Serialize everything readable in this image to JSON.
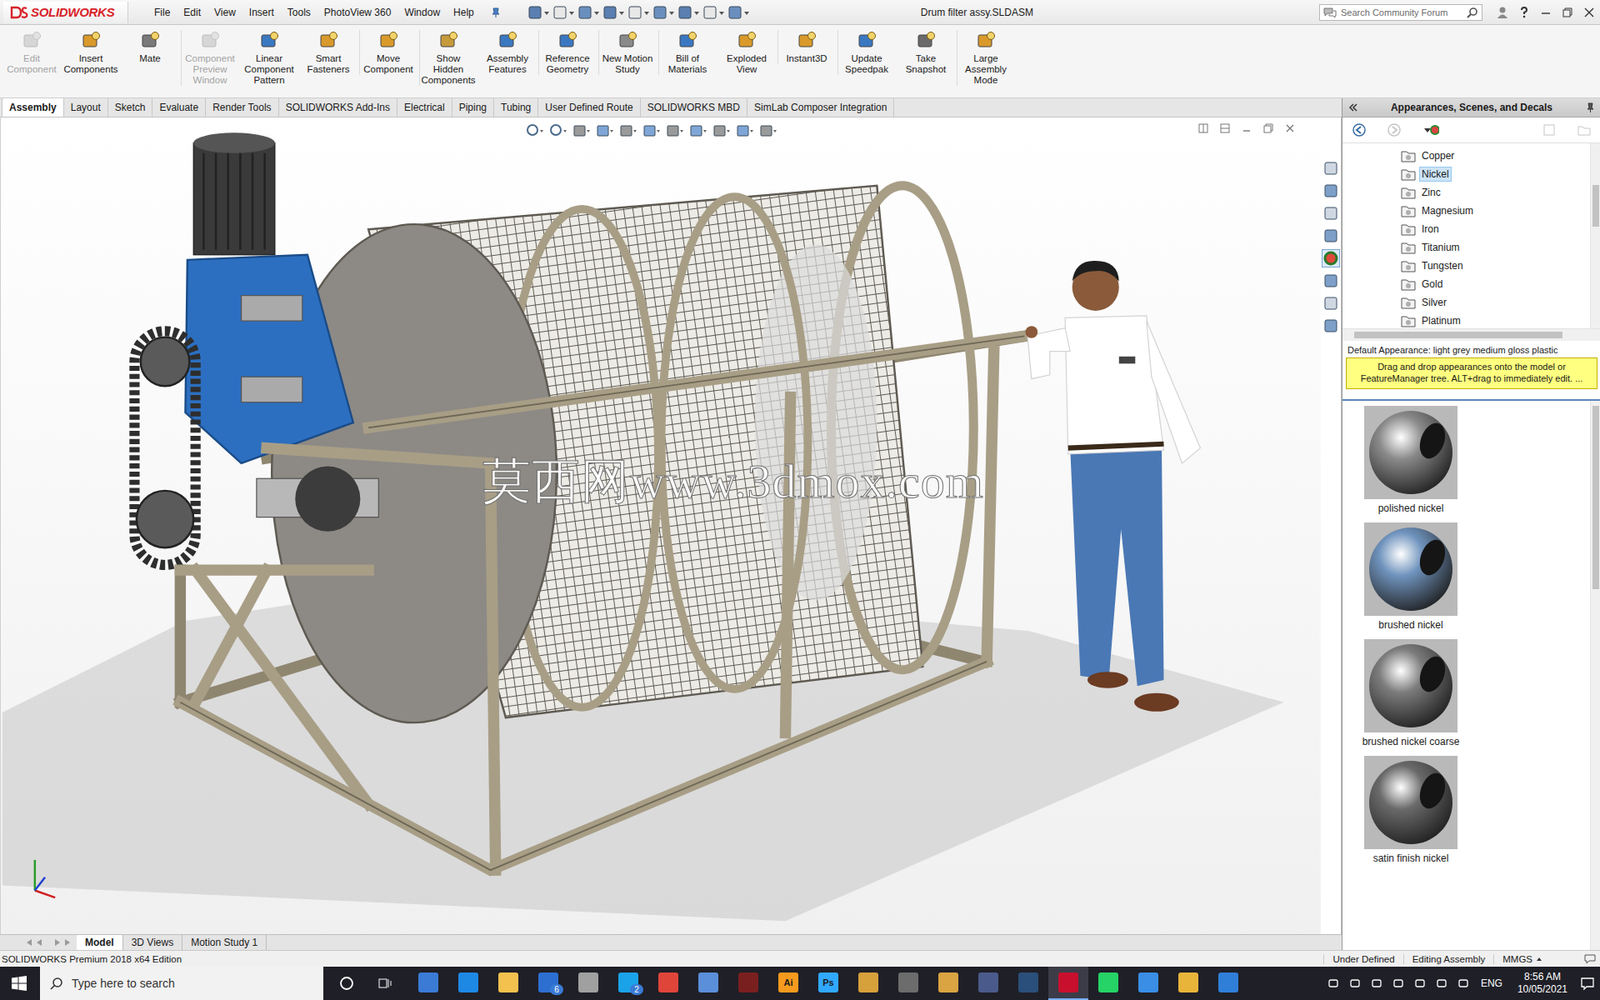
{
  "app": {
    "logo": "SOLIDWORKS"
  },
  "menu": [
    "File",
    "Edit",
    "View",
    "Insert",
    "Tools",
    "PhotoView 360",
    "Window",
    "Help"
  ],
  "window": {
    "title": "Drum filter assy.SLDASM"
  },
  "search": {
    "placeholder": "Search Community Forum"
  },
  "ribbon": [
    {
      "label": "Edit Component",
      "disabled": true
    },
    {
      "label": "Insert Components",
      "disabled": false
    },
    {
      "label": "Mate",
      "disabled": false
    },
    {
      "label": "Component Preview Window",
      "disabled": true
    },
    {
      "label": "Linear Component Pattern",
      "disabled": false
    },
    {
      "label": "Smart Fasteners",
      "disabled": false
    },
    {
      "label": "Move Component",
      "disabled": false
    },
    {
      "label": "Show Hidden Components",
      "disabled": false
    },
    {
      "label": "Assembly Features",
      "disabled": false
    },
    {
      "label": "Reference Geometry",
      "disabled": false
    },
    {
      "label": "New Motion Study",
      "disabled": false
    },
    {
      "label": "Bill of Materials",
      "disabled": false
    },
    {
      "label": "Exploded View",
      "disabled": false
    },
    {
      "label": "Instant3D",
      "disabled": false
    },
    {
      "label": "Update Speedpak",
      "disabled": false
    },
    {
      "label": "Take Snapshot",
      "disabled": false
    },
    {
      "label": "Large Assembly Mode",
      "disabled": false
    }
  ],
  "tabs": [
    {
      "label": "Assembly",
      "selected": true
    },
    {
      "label": "Layout",
      "selected": false
    },
    {
      "label": "Sketch",
      "selected": false
    },
    {
      "label": "Evaluate",
      "selected": false
    },
    {
      "label": "Render Tools",
      "selected": false
    },
    {
      "label": "SOLIDWORKS Add-Ins",
      "selected": false
    },
    {
      "label": "Electrical",
      "selected": false
    },
    {
      "label": "Piping",
      "selected": false
    },
    {
      "label": "Tubing",
      "selected": false
    },
    {
      "label": "User Defined Route",
      "selected": false
    },
    {
      "label": "SOLIDWORKS MBD",
      "selected": false
    },
    {
      "label": "SimLab Composer Integration",
      "selected": false
    }
  ],
  "viewport": {
    "watermark": "莫西网www.3dmox.com"
  },
  "bottom_tabs": [
    {
      "label": "Model",
      "selected": true
    },
    {
      "label": "3D Views",
      "selected": false
    },
    {
      "label": "Motion Study 1",
      "selected": false
    }
  ],
  "status_bar": {
    "edition": "SOLIDWORKS Premium 2018 x64 Edition",
    "state": "Under Defined",
    "mode": "Editing Assembly",
    "units": "MMGS"
  },
  "task_pane": {
    "title": "Appearances, Scenes, and Decals",
    "tree": [
      {
        "label": "Copper",
        "selected": false
      },
      {
        "label": "Nickel",
        "selected": true
      },
      {
        "label": "Zinc",
        "selected": false
      },
      {
        "label": "Magnesium",
        "selected": false
      },
      {
        "label": "Iron",
        "selected": false
      },
      {
        "label": "Titanium",
        "selected": false
      },
      {
        "label": "Tungsten",
        "selected": false
      },
      {
        "label": "Gold",
        "selected": false
      },
      {
        "label": "Silver",
        "selected": false
      },
      {
        "label": "Platinum",
        "selected": false
      }
    ],
    "default_appearance": "Default Appearance: light grey medium gloss plastic",
    "tip": "Drag and drop appearances onto the model or FeatureManager tree.  ALT+drag to immediately edit. ...",
    "swatches": [
      {
        "label": "polished nickel",
        "color": "#8a8a8a"
      },
      {
        "label": "brushed nickel",
        "color": "#6f93bd"
      },
      {
        "label": "brushed nickel coarse",
        "color": "#7c7c7c"
      },
      {
        "label": "satin finish nickel",
        "color": "#6a6a6a"
      }
    ]
  },
  "taskbar": {
    "search_placeholder": "Type here to search",
    "apps": [
      {
        "color": "#3b7bd6",
        "selected": false
      },
      {
        "color": "#1e88e5",
        "selected": false
      },
      {
        "color": "#f2c14e",
        "selected": false
      },
      {
        "color": "#2d6fd1",
        "badge": "6",
        "selected": false
      },
      {
        "color": "#a0a0a0",
        "selected": false
      },
      {
        "color": "#1aa3e8",
        "badge": "2",
        "selected": false
      },
      {
        "color": "#e0453a",
        "selected": false
      },
      {
        "color": "#5b8fd9",
        "selected": false
      },
      {
        "color": "#7a1f1f",
        "selected": false
      },
      {
        "color": "#f79a1e",
        "label": "Ai",
        "selected": false
      },
      {
        "color": "#31a8ff",
        "label": "Ps",
        "selected": false
      },
      {
        "color": "#d6a03a",
        "selected": false
      },
      {
        "color": "#6c6c6c",
        "selected": false
      },
      {
        "color": "#d9a441",
        "selected": false
      },
      {
        "color": "#4a5a8a",
        "selected": false
      },
      {
        "color": "#2a4f7a",
        "selected": false
      },
      {
        "color": "#c8102e",
        "selected": true
      },
      {
        "color": "#25d366",
        "selected": false
      },
      {
        "color": "#3a8ee6",
        "selected": false
      },
      {
        "color": "#e8b53a",
        "selected": false
      },
      {
        "color": "#2f7fd8",
        "selected": false
      }
    ],
    "language": "ENG",
    "time": "8:56 AM",
    "date": "10/05/2021"
  }
}
